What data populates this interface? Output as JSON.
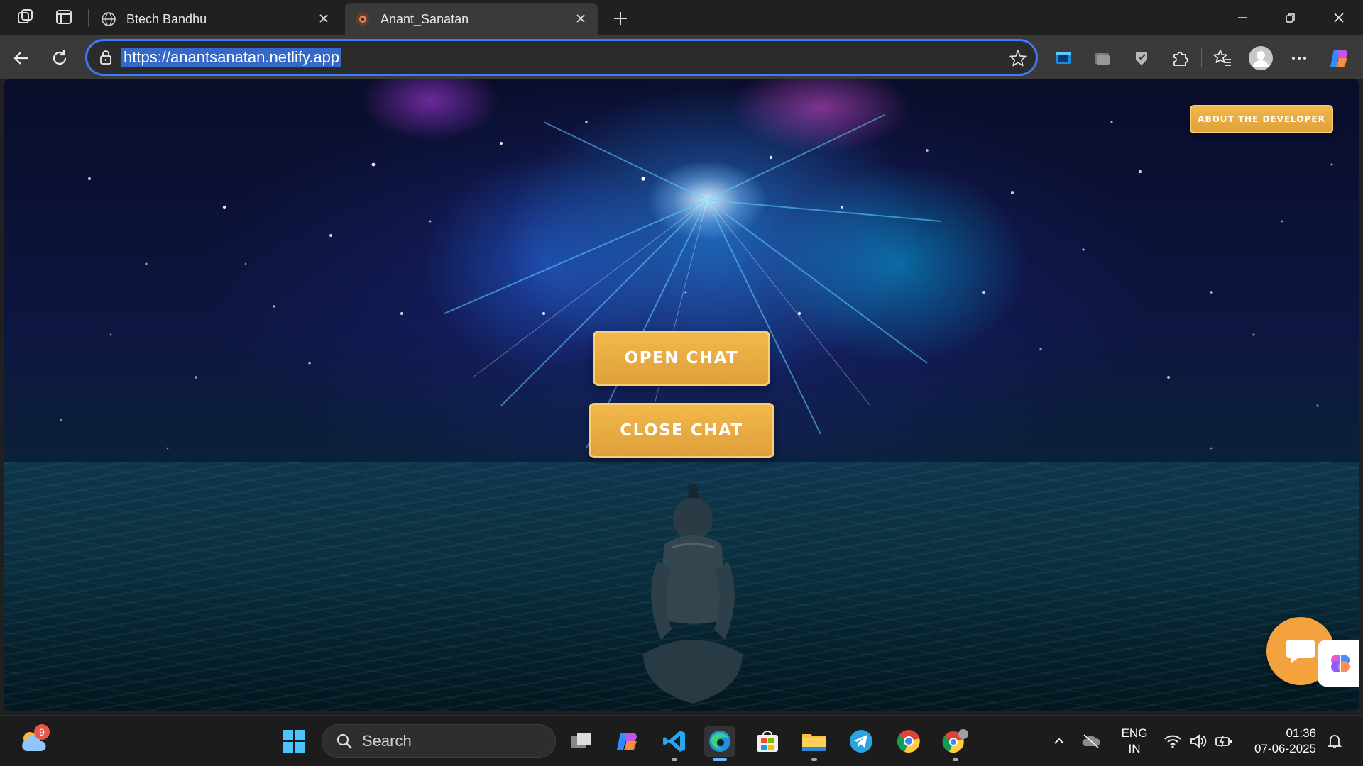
{
  "browser": {
    "tabs": [
      {
        "title": "Btech Bandhu",
        "active": false
      },
      {
        "title": "Anant_Sanatan",
        "active": true
      }
    ],
    "url": "https://anantsanatan.netlify.app"
  },
  "page": {
    "about_button": "ABOUT THE DEVELOPER",
    "open_chat_button": "OPEN CHAT",
    "close_chat_button": "CLOSE CHAT",
    "accent_color": "#E8A83E"
  },
  "taskbar": {
    "weather_badge": "9",
    "search_placeholder": "Search",
    "language_line1": "ENG",
    "language_line2": "IN",
    "time": "01:36",
    "date": "07-06-2025",
    "pinned_apps": [
      "task-view",
      "copilot",
      "vs-code",
      "edge",
      "microsoft-store",
      "file-explorer",
      "telegram",
      "chrome",
      "chrome-profile"
    ]
  }
}
